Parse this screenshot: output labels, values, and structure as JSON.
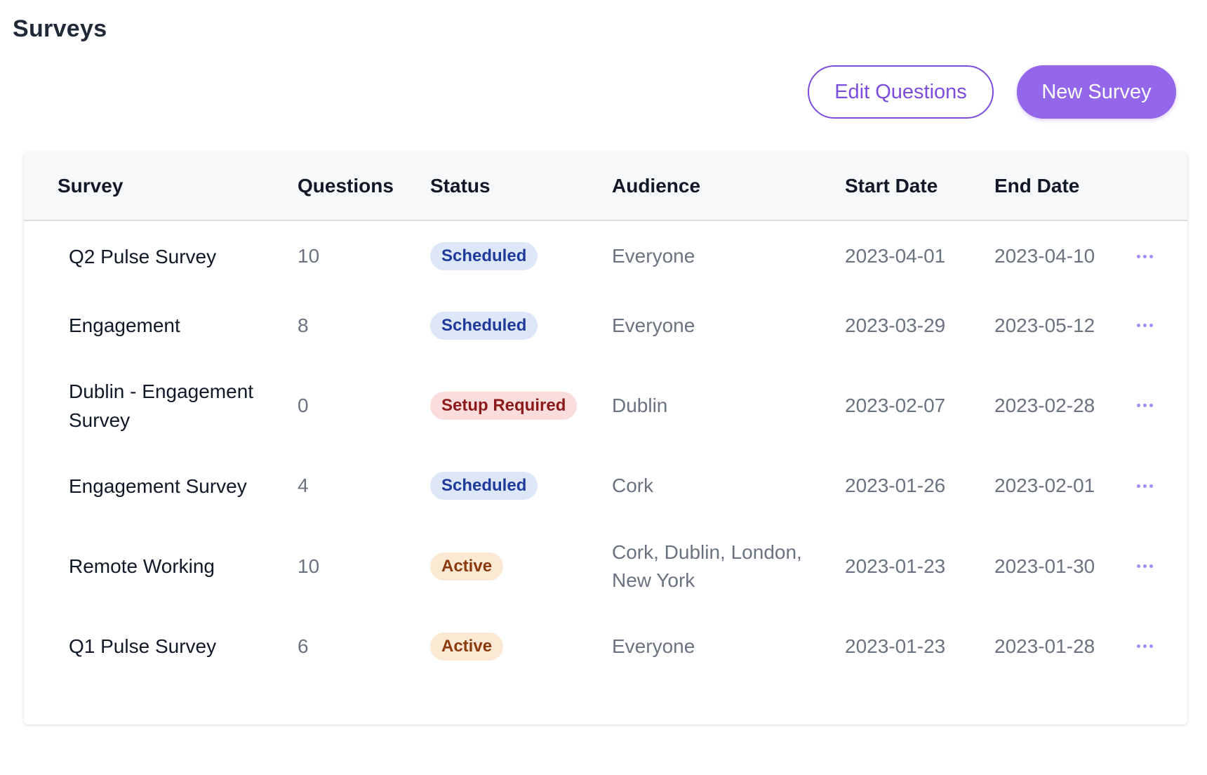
{
  "page": {
    "title": "Surveys"
  },
  "toolbar": {
    "edit_label": "Edit Questions",
    "new_label": "New Survey"
  },
  "colors": {
    "accent": "#9366ea",
    "scheduled_bg": "#dde7f8",
    "setup_bg": "#fadcdc",
    "active_bg": "#fbe9d4"
  },
  "table": {
    "headers": [
      "Survey",
      "Questions",
      "Status",
      "Audience",
      "Start Date",
      "End Date"
    ],
    "rows": [
      {
        "name": "Q2 Pulse Survey",
        "questions": "10",
        "status": "Scheduled",
        "status_type": "scheduled",
        "audience": "Everyone",
        "start": "2023-04-01",
        "end": "2023-04-10",
        "menu_icon": "more-horizontal-icon"
      },
      {
        "name": "Engagement",
        "questions": "8",
        "status": "Scheduled",
        "status_type": "scheduled",
        "audience": "Everyone",
        "start": "2023-03-29",
        "end": "2023-05-12",
        "menu_icon": "more-horizontal-icon"
      },
      {
        "name": "Dublin - Engagement Survey",
        "questions": "0",
        "status": "Setup Required",
        "status_type": "setup",
        "audience": "Dublin",
        "start": "2023-02-07",
        "end": "2023-02-28",
        "menu_icon": "more-horizontal-icon"
      },
      {
        "name": "Engagement Survey",
        "questions": "4",
        "status": "Scheduled",
        "status_type": "scheduled",
        "audience": "Cork",
        "start": "2023-01-26",
        "end": "2023-02-01",
        "menu_icon": "more-horizontal-icon"
      },
      {
        "name": "Remote Working",
        "questions": "10",
        "status": "Active",
        "status_type": "active",
        "audience": "Cork, Dublin, London, New York",
        "start": "2023-01-23",
        "end": "2023-01-30",
        "menu_icon": "more-horizontal-icon"
      },
      {
        "name": "Q1 Pulse Survey",
        "questions": "6",
        "status": "Active",
        "status_type": "active",
        "audience": "Everyone",
        "start": "2023-01-23",
        "end": "2023-01-28",
        "menu_icon": "more-horizontal-icon"
      }
    ]
  }
}
